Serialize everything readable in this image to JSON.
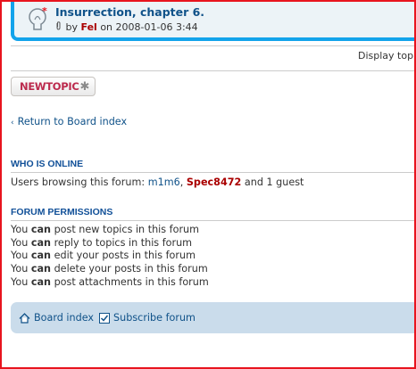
{
  "topic": {
    "title": "Insurrection, chapter 6.",
    "by_prefix": "by",
    "author": "Fel",
    "on_prefix": "on",
    "date": "2008-01-06 3:44"
  },
  "display_topics_label": "Display top",
  "newtopic_label": "NEWTOPIC",
  "return_link": "Return to Board index",
  "who_is_online": {
    "heading": "WHO IS ONLINE",
    "prefix": "Users browsing this forum:",
    "user1": "m1m6",
    "separator": ",",
    "user2": "Spec8472",
    "suffix": "and 1 guest"
  },
  "permissions": {
    "heading": "FORUM PERMISSIONS",
    "you": "You",
    "can": "can",
    "items": [
      "post new topics in this forum",
      "reply to topics in this forum",
      "edit your posts in this forum",
      "delete your posts in this forum",
      "post attachments in this forum"
    ]
  },
  "footer_nav": {
    "board_index": "Board index",
    "subscribe": "Subscribe forum"
  }
}
